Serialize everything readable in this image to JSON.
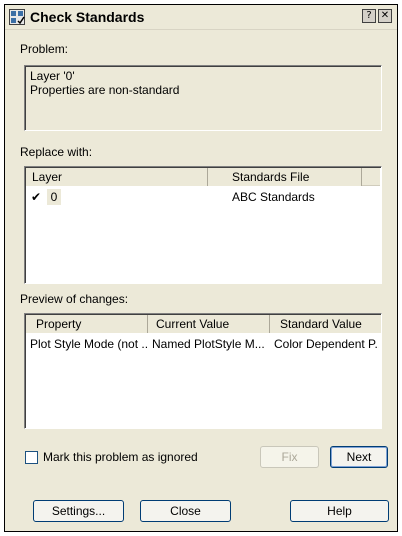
{
  "window": {
    "title": "Check Standards",
    "help_glyph": "?",
    "close_glyph": "✕"
  },
  "problem": {
    "label": "Problem:",
    "line1": "Layer '0'",
    "line2": "Properties are non-standard"
  },
  "replace": {
    "label": "Replace with:",
    "columns": [
      "Layer",
      "Standards File"
    ],
    "rows": [
      {
        "check": "✔",
        "layer": "0",
        "file": "ABC Standards"
      }
    ]
  },
  "preview": {
    "label": "Preview of changes:",
    "columns": [
      "Property",
      "Current Value",
      "Standard Value"
    ],
    "rows": [
      {
        "property": "Plot Style Mode (not ...",
        "current": "Named PlotStyle M...",
        "standard": "Color Dependent P..."
      }
    ]
  },
  "ignore": {
    "label": "Mark this problem as ignored",
    "checked": false
  },
  "buttons": {
    "fix": "Fix",
    "next": "Next",
    "settings": "Settings...",
    "close": "Close",
    "help": "Help"
  }
}
